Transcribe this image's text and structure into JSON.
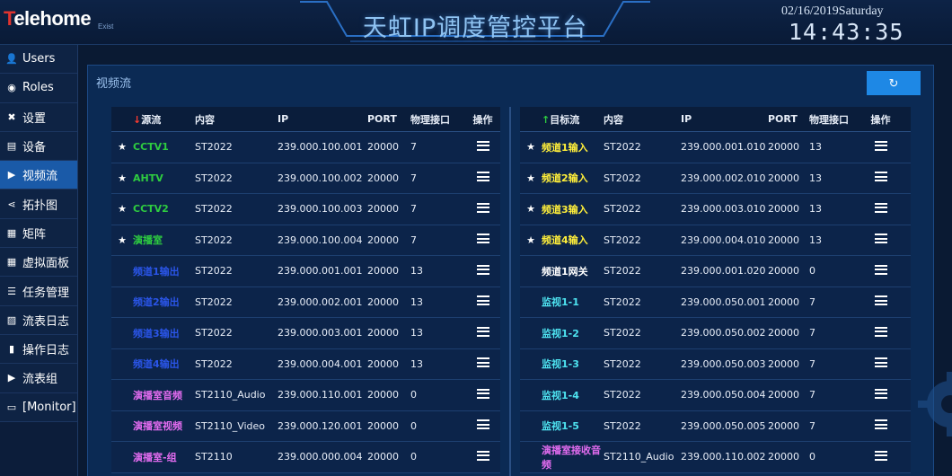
{
  "app": {
    "logo_first": "T",
    "logo_rest": "elehome",
    "logo_exist": "Exist",
    "title": "天虹IP调度管控平台",
    "date": "02/16/2019Saturday",
    "time": "14:43:35"
  },
  "sidebar": {
    "items": [
      {
        "label": "Users",
        "icon": "user-icon",
        "active": false
      },
      {
        "label": "Roles",
        "icon": "shield-icon",
        "active": false
      },
      {
        "label": "设置",
        "icon": "tools-icon",
        "active": false
      },
      {
        "label": "设备",
        "icon": "device-icon",
        "active": false
      },
      {
        "label": "视频流",
        "icon": "play-icon",
        "active": true
      },
      {
        "label": "拓扑图",
        "icon": "share-icon",
        "active": false
      },
      {
        "label": "矩阵",
        "icon": "matrix-icon",
        "active": false
      },
      {
        "label": "虚拟面板",
        "icon": "grid-icon",
        "active": false
      },
      {
        "label": "任务管理",
        "icon": "list-icon",
        "active": false
      },
      {
        "label": "流表日志",
        "icon": "chart-icon",
        "active": false
      },
      {
        "label": "操作日志",
        "icon": "file-icon",
        "active": false
      },
      {
        "label": "流表组",
        "icon": "play-icon",
        "active": false
      },
      {
        "label": "[Monitor]",
        "icon": "monitor-icon",
        "active": false
      }
    ]
  },
  "panel": {
    "title": "视频流",
    "refresh_icon": "↻"
  },
  "colors": {
    "green": "#2ecc40",
    "blue": "#2a55e8",
    "pink": "#e36cf0",
    "yellow": "#ffef3a",
    "cyan": "#4ee3f0",
    "white": "#ffffff",
    "accent": "#1e88e5"
  },
  "left_table": {
    "headers": {
      "name": "源流",
      "content": "内容",
      "ip": "IP",
      "port": "PORT",
      "phy": "物理接口",
      "op": "操作"
    },
    "rows": [
      {
        "star": true,
        "name": "CCTV1",
        "color": "#2ecc40",
        "content": "ST2022",
        "ip": "239.000.100.001",
        "port": "20000",
        "phy": "7"
      },
      {
        "star": true,
        "name": "AHTV",
        "color": "#2ecc40",
        "content": "ST2022",
        "ip": "239.000.100.002",
        "port": "20000",
        "phy": "7"
      },
      {
        "star": true,
        "name": "CCTV2",
        "color": "#2ecc40",
        "content": "ST2022",
        "ip": "239.000.100.003",
        "port": "20000",
        "phy": "7"
      },
      {
        "star": true,
        "name": "演播室",
        "color": "#2ecc40",
        "content": "ST2022",
        "ip": "239.000.100.004",
        "port": "20000",
        "phy": "7"
      },
      {
        "star": false,
        "name": "频道1输出",
        "color": "#2a55e8",
        "content": "ST2022",
        "ip": "239.000.001.001",
        "port": "20000",
        "phy": "13"
      },
      {
        "star": false,
        "name": "频道2输出",
        "color": "#2a55e8",
        "content": "ST2022",
        "ip": "239.000.002.001",
        "port": "20000",
        "phy": "13"
      },
      {
        "star": false,
        "name": "频道3输出",
        "color": "#2a55e8",
        "content": "ST2022",
        "ip": "239.000.003.001",
        "port": "20000",
        "phy": "13"
      },
      {
        "star": false,
        "name": "频道4输出",
        "color": "#2a55e8",
        "content": "ST2022",
        "ip": "239.000.004.001",
        "port": "20000",
        "phy": "13"
      },
      {
        "star": false,
        "name": "演播室音频",
        "color": "#e36cf0",
        "content": "ST2110_Audio",
        "ip": "239.000.110.001",
        "port": "20000",
        "phy": "0"
      },
      {
        "star": false,
        "name": "演播室视频",
        "color": "#e36cf0",
        "content": "ST2110_Video",
        "ip": "239.000.120.001",
        "port": "20000",
        "phy": "0"
      },
      {
        "star": false,
        "name": "演播室-组",
        "color": "#e36cf0",
        "content": "ST2110",
        "ip": "239.000.000.004",
        "port": "20000",
        "phy": "0"
      }
    ]
  },
  "right_table": {
    "headers": {
      "name": "目标流",
      "content": "内容",
      "ip": "IP",
      "port": "PORT",
      "phy": "物理接口",
      "op": "操作"
    },
    "rows": [
      {
        "star": true,
        "name": "频道1输入",
        "color": "#ffef3a",
        "content": "ST2022",
        "ip": "239.000.001.010",
        "port": "20000",
        "phy": "13"
      },
      {
        "star": true,
        "name": "频道2输入",
        "color": "#ffef3a",
        "content": "ST2022",
        "ip": "239.000.002.010",
        "port": "20000",
        "phy": "13"
      },
      {
        "star": true,
        "name": "频道3输入",
        "color": "#ffef3a",
        "content": "ST2022",
        "ip": "239.000.003.010",
        "port": "20000",
        "phy": "13"
      },
      {
        "star": true,
        "name": "频道4输入",
        "color": "#ffef3a",
        "content": "ST2022",
        "ip": "239.000.004.010",
        "port": "20000",
        "phy": "13"
      },
      {
        "star": false,
        "name": "频道1网关",
        "color": "#ffffff",
        "content": "ST2022",
        "ip": "239.000.001.020",
        "port": "20000",
        "phy": "0"
      },
      {
        "star": false,
        "name": "监视1-1",
        "color": "#4ee3f0",
        "content": "ST2022",
        "ip": "239.000.050.001",
        "port": "20000",
        "phy": "7"
      },
      {
        "star": false,
        "name": "监视1-2",
        "color": "#4ee3f0",
        "content": "ST2022",
        "ip": "239.000.050.002",
        "port": "20000",
        "phy": "7"
      },
      {
        "star": false,
        "name": "监视1-3",
        "color": "#4ee3f0",
        "content": "ST2022",
        "ip": "239.000.050.003",
        "port": "20000",
        "phy": "7"
      },
      {
        "star": false,
        "name": "监视1-4",
        "color": "#4ee3f0",
        "content": "ST2022",
        "ip": "239.000.050.004",
        "port": "20000",
        "phy": "7"
      },
      {
        "star": false,
        "name": "监视1-5",
        "color": "#4ee3f0",
        "content": "ST2022",
        "ip": "239.000.050.005",
        "port": "20000",
        "phy": "7"
      },
      {
        "star": false,
        "name": "演播室接收音频",
        "color": "#e36cf0",
        "content": "ST2110_Audio",
        "ip": "239.000.110.002",
        "port": "20000",
        "phy": "0"
      }
    ]
  }
}
